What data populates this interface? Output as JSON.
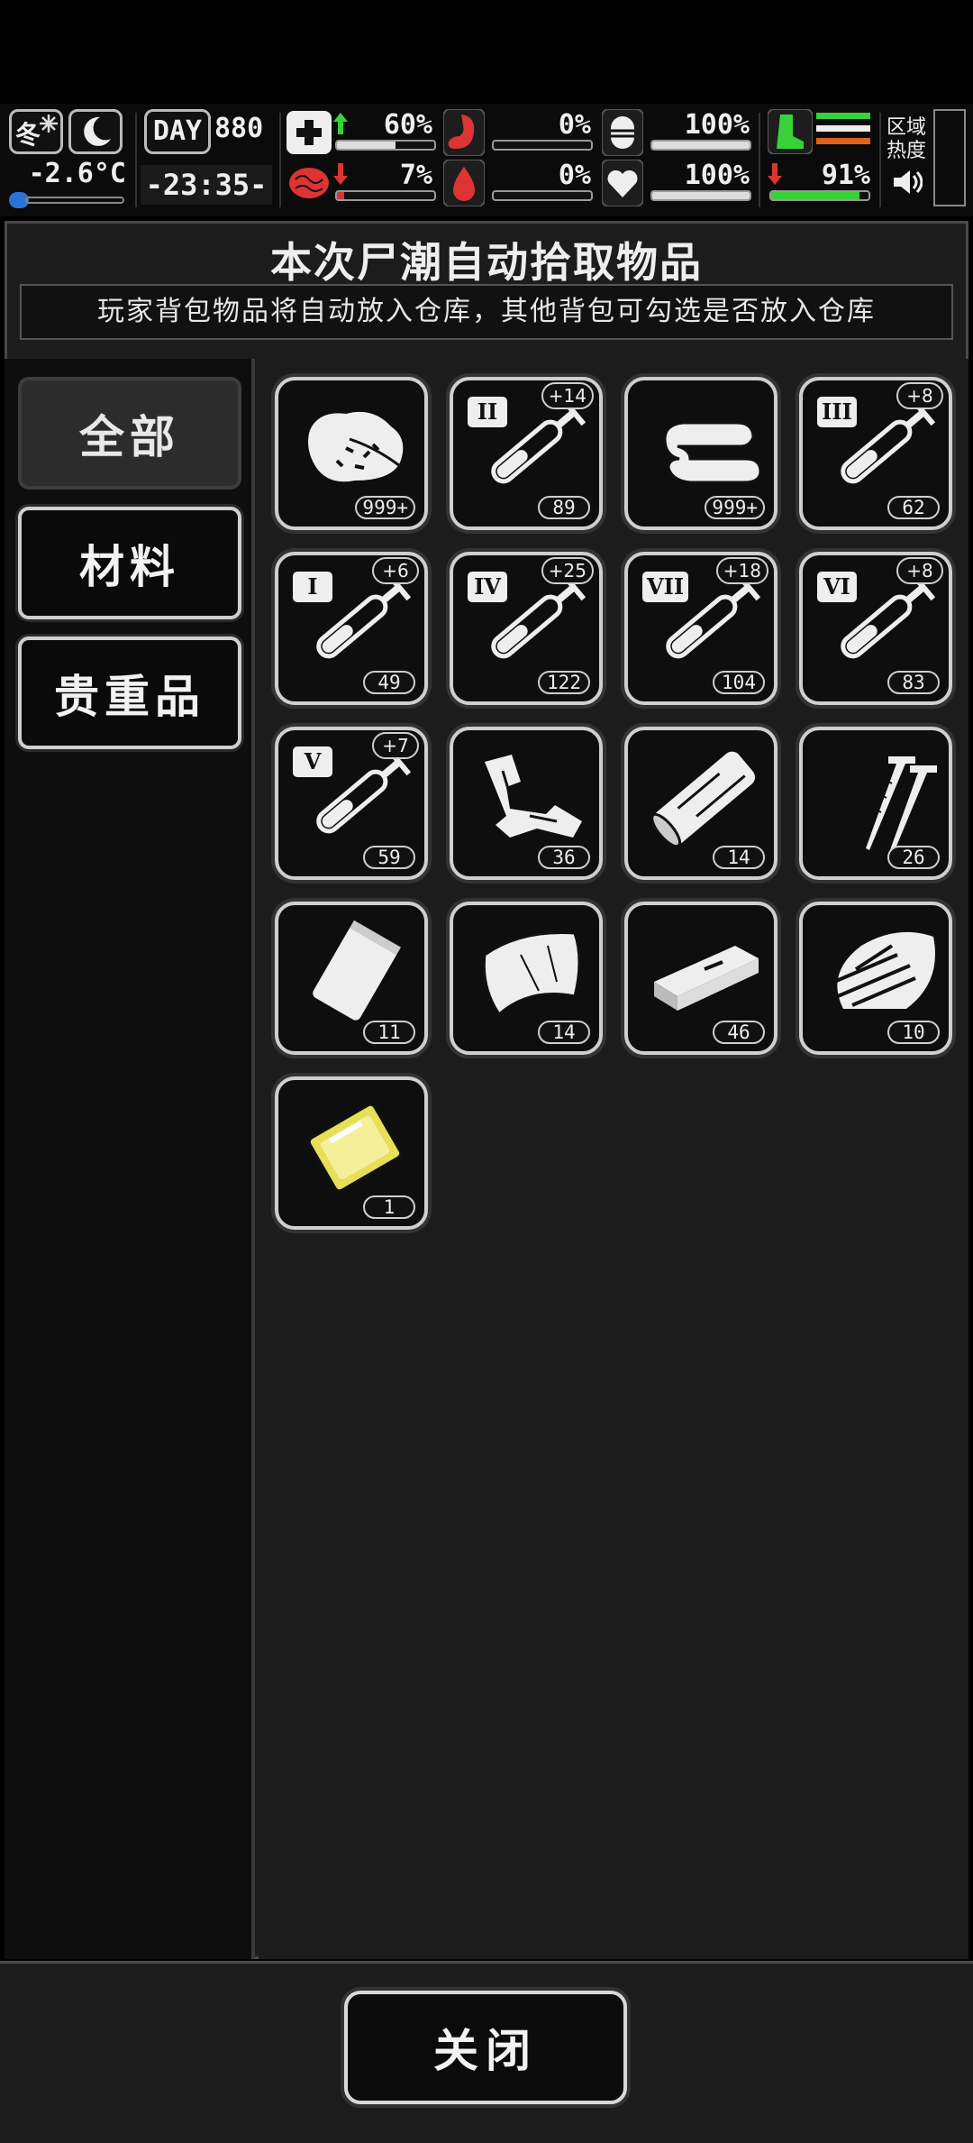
{
  "hud": {
    "season": "冬",
    "temperature": "-2.6°C",
    "day_label": "DAY",
    "day_value": "880",
    "time": "-23:35-",
    "health_pct": "60%",
    "hunger_pct": "0%",
    "armor_pct": "100%",
    "brain_pct": "7%",
    "blood_pct": "0%",
    "heart_pct": "100%",
    "stamina_pct": "91%",
    "health_level": 0.6,
    "brain_level": 0.07,
    "stamina_level": 0.91,
    "zone_label_1": "区域",
    "zone_label_2": "热度",
    "colors": {
      "accent_green": "#39d13a",
      "accent_red": "#d33333",
      "hud_bg": "#0b0b0b"
    }
  },
  "dialog": {
    "title": "本次尸潮自动拾取物品",
    "notice": "玩家背包物品将自动放入仓库，其他背包可勾选是否放入仓库",
    "close_label": "关闭"
  },
  "tabs": [
    {
      "label": "全部",
      "active": true
    },
    {
      "label": "材料",
      "active": false
    },
    {
      "label": "贵重品",
      "active": false
    }
  ],
  "items": [
    {
      "icon": "meat-chunk-icon",
      "count": "999+"
    },
    {
      "icon": "syringe-icon",
      "tier": "II",
      "bonus": "+14",
      "count": "89"
    },
    {
      "icon": "cloth-stack-icon",
      "count": "999+"
    },
    {
      "icon": "syringe-icon",
      "tier": "III",
      "bonus": "+8",
      "count": "62"
    },
    {
      "icon": "syringe-icon",
      "tier": "I",
      "bonus": "+6",
      "count": "49"
    },
    {
      "icon": "syringe-icon",
      "tier": "IV",
      "bonus": "+25",
      "count": "122"
    },
    {
      "icon": "syringe-icon",
      "tier": "VII",
      "bonus": "+18",
      "count": "104"
    },
    {
      "icon": "syringe-icon",
      "tier": "VI",
      "bonus": "+8",
      "count": "83"
    },
    {
      "icon": "syringe-icon",
      "tier": "V",
      "bonus": "+7",
      "count": "59"
    },
    {
      "icon": "scrap-metal-icon",
      "count": "36"
    },
    {
      "icon": "wood-log-icon",
      "count": "14"
    },
    {
      "icon": "nails-icon",
      "count": "26"
    },
    {
      "icon": "paper-bag-icon",
      "count": "11"
    },
    {
      "icon": "leather-sheet-icon",
      "count": "14"
    },
    {
      "icon": "wood-plank-icon",
      "count": "46"
    },
    {
      "icon": "broken-wood-icon",
      "count": "10"
    },
    {
      "icon": "gold-plate-icon",
      "count": "1"
    }
  ]
}
